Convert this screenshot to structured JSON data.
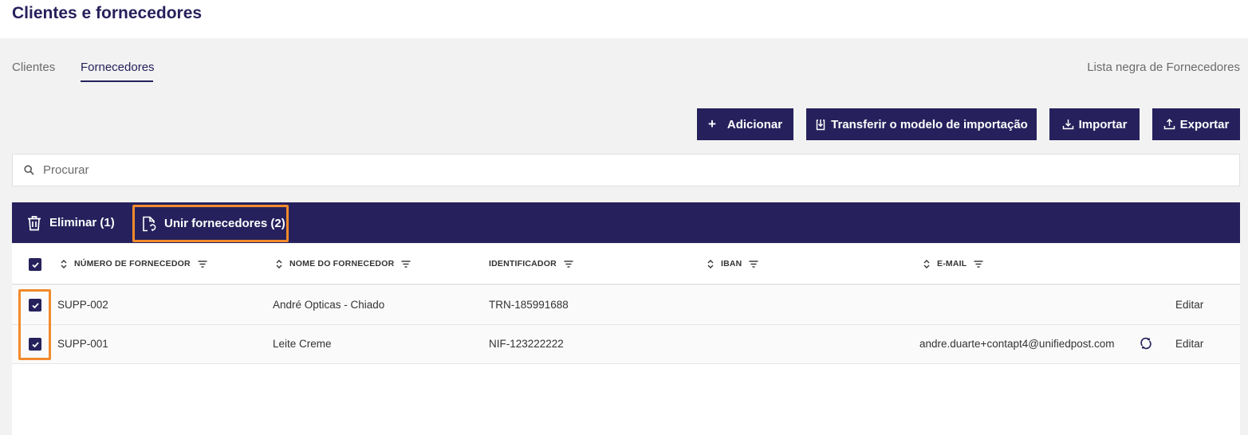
{
  "header": {
    "title": "Clientes e fornecedores"
  },
  "tabs": [
    {
      "label": "Clientes"
    },
    {
      "label": "Fornecedores",
      "active": true
    }
  ],
  "blacklist_label": "Lista negra de Fornecedores",
  "toolbar": {
    "add_label": "Adicionar",
    "template_label": "Transferir o modelo de importação",
    "import_label": "Importar",
    "export_label": "Exportar"
  },
  "search": {
    "placeholder": "Procurar"
  },
  "bulk_actions": {
    "delete_label": "Eliminar (1)",
    "merge_label": "Unir fornecedores (2)"
  },
  "table": {
    "columns": [
      "NÚMERO DE FORNECEDOR",
      "NOME DO FORNECEDOR",
      "IDENTIFICADOR",
      "IBAN",
      "E-MAIL"
    ],
    "rows": [
      {
        "number": "SUPP-002",
        "name": "André Opticas - Chiado",
        "identifier": "TRN-185991688",
        "iban": "",
        "email": "",
        "edit": "Editar",
        "checked": true
      },
      {
        "number": "SUPP-001",
        "name": "Leite Creme",
        "identifier": "NIF-123222222",
        "iban": "",
        "email": "andre.duarte+contapt4@unifiedpost.com",
        "edit": "Editar",
        "checked": true
      }
    ]
  },
  "colors": {
    "primary": "#26215c",
    "highlight": "#f28a2c",
    "background": "#f2f2f2"
  }
}
